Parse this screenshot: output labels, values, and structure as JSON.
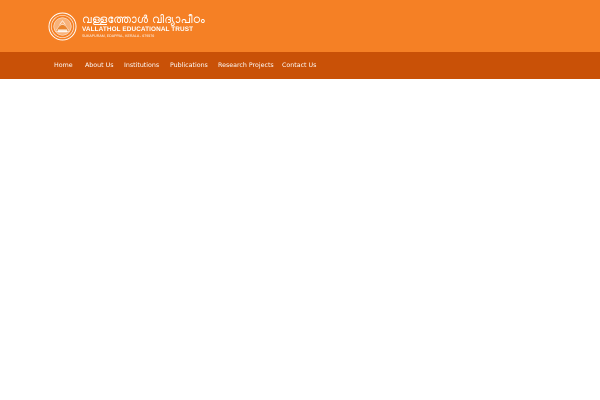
{
  "header": {
    "background_color": "#f58025",
    "logo": {
      "seal_icon": "temple-seal-icon",
      "malayalam_title": "വള്ളത്തോൾ വിദ്യാപീഠം",
      "english_title": "VALLATHOL EDUCATIONAL TRUST",
      "subtitle": "SUKAPURAM, EDAPPAL, KERALA - 679576"
    }
  },
  "navbar": {
    "background_color": "#c95107",
    "items": [
      {
        "label": "Home"
      },
      {
        "label": "About Us"
      },
      {
        "label": "Institutions"
      },
      {
        "label": "Publications"
      },
      {
        "label": "Research Projects"
      },
      {
        "label": "Contact Us"
      }
    ]
  }
}
